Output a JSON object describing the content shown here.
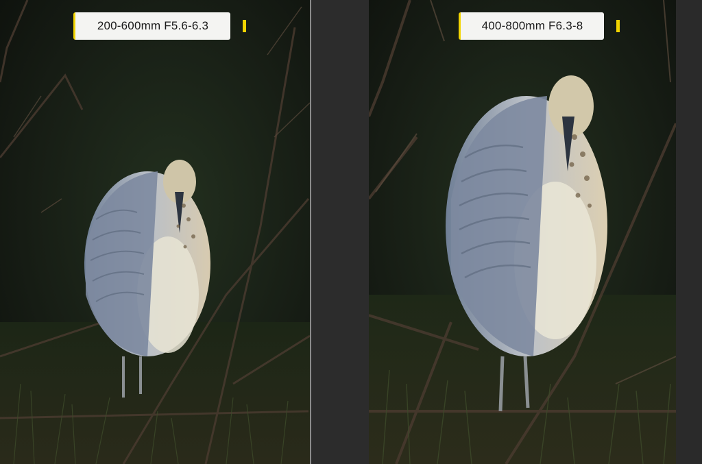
{
  "comparison": {
    "left": {
      "lens_label": "200-600mm F5.6-6.3",
      "subject_icon": "heron-photo"
    },
    "right": {
      "lens_label": "400-800mm F6.3-8",
      "subject_icon": "heron-photo"
    }
  },
  "colors": {
    "label_bg": "#f4f4f2",
    "accent_yellow": "#f2d400",
    "divider": "#8a8a8a",
    "background": "#2b2b2b"
  }
}
